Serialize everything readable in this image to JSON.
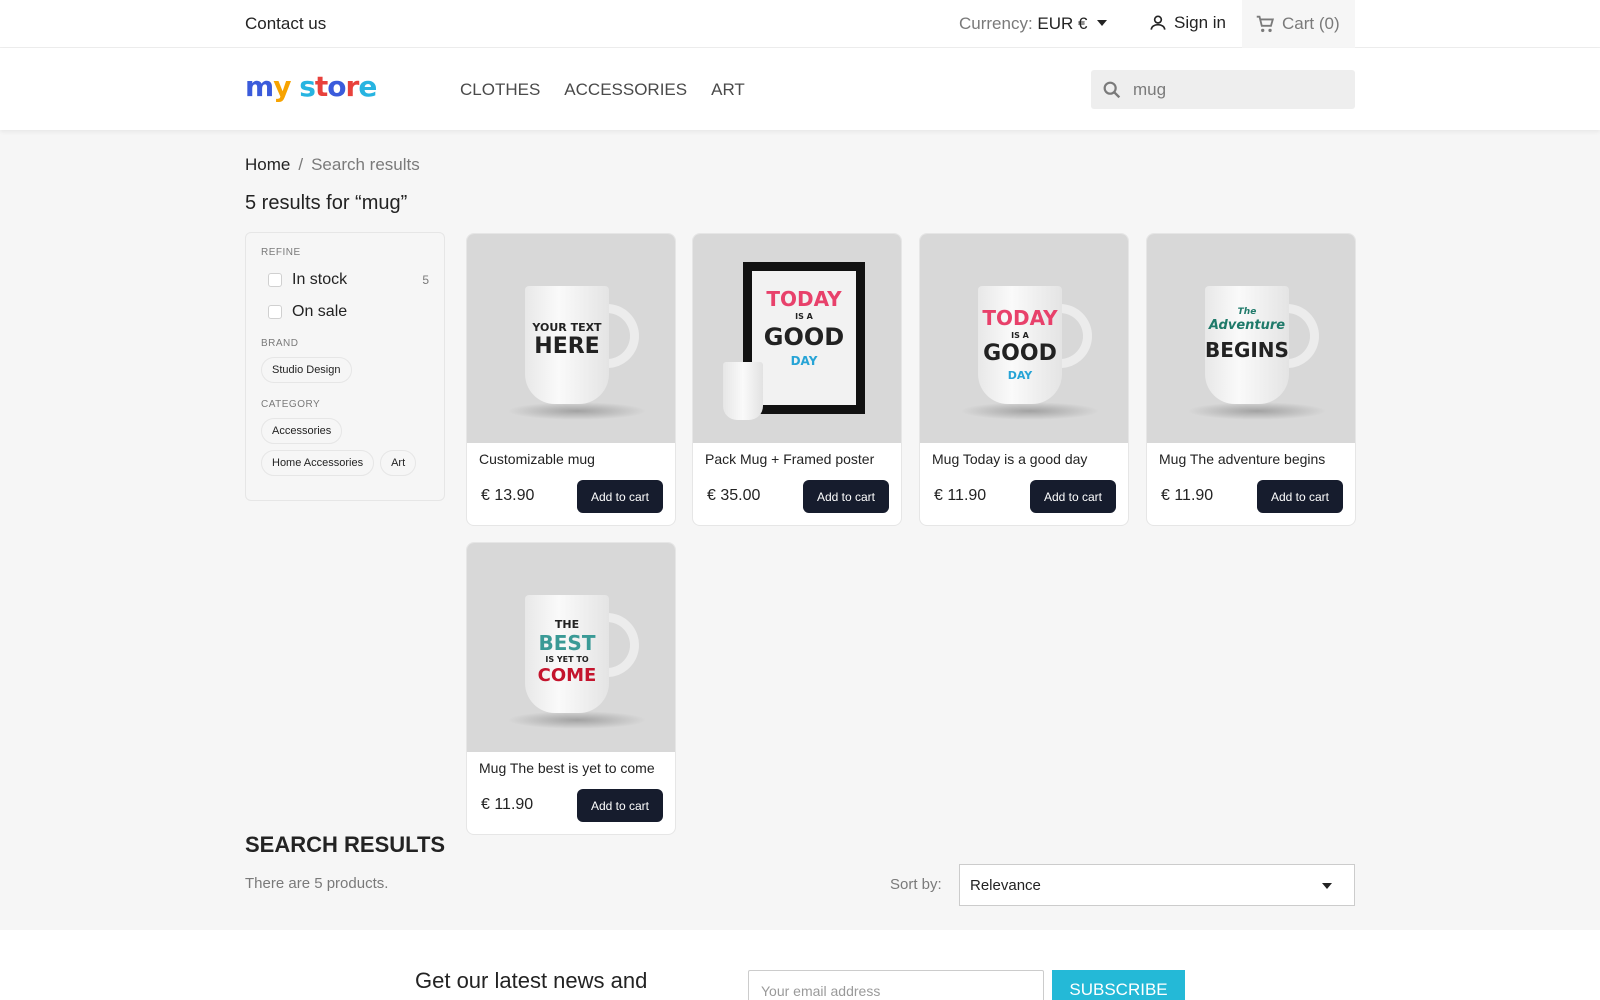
{
  "topbar": {
    "contact": "Contact us",
    "currency_label": "Currency:",
    "currency_value": "EUR €",
    "signin": "Sign in",
    "cart": "Cart (0)"
  },
  "header": {
    "logo_letters": [
      "m",
      "y",
      " ",
      "s",
      "t",
      "o",
      "r",
      "e"
    ],
    "nav": [
      "CLOTHES",
      "ACCESSORIES",
      "ART"
    ],
    "search_value": "mug"
  },
  "breadcrumb": {
    "home": "Home",
    "sep": "/",
    "current": "Search results"
  },
  "results_title": "5 results for “mug”",
  "facets": {
    "refine": "REFINE",
    "in_stock": "In stock",
    "in_stock_count": "5",
    "on_sale": "On sale",
    "brand": "BRAND",
    "brand_items": [
      "Studio Design"
    ],
    "category": "CATEGORY",
    "category_items": [
      "Accessories",
      "Home Accessories",
      "Art"
    ]
  },
  "products": [
    {
      "name": "Customizable mug",
      "price": "€ 13.90",
      "button": "Add to cart",
      "art": [
        "YOUR TEXT",
        "HERE"
      ]
    },
    {
      "name": "Pack Mug + Framed poster",
      "price": "€ 35.00",
      "button": "Add to cart",
      "art": [
        "TODAY",
        "IS A",
        "GOOD",
        "DAY"
      ]
    },
    {
      "name": "Mug Today is a good day",
      "price": "€ 11.90",
      "button": "Add to cart",
      "art": [
        "TODAY",
        "IS A",
        "GOOD",
        "DAY"
      ]
    },
    {
      "name": "Mug The adventure begins",
      "price": "€ 11.90",
      "button": "Add to cart",
      "art": [
        "The",
        "Adventure",
        "BEGINS"
      ]
    },
    {
      "name": "Mug The best is yet to come",
      "price": "€ 11.90",
      "button": "Add to cart",
      "art": [
        "THE",
        "BEST",
        "IS YET TO",
        "COME"
      ]
    }
  ],
  "search_results": {
    "title": "SEARCH RESULTS",
    "count": "There are 5 products.",
    "sort_label": "Sort by:",
    "sort_value": "Relevance"
  },
  "newsletter": {
    "heading": "Get our latest news and",
    "email_placeholder": "Your email address",
    "subscribe": "SUBSCRIBE"
  },
  "colors": {
    "logo": [
      "#3b5bdb",
      "#f7a300",
      "#ffffff",
      "#27b4e1",
      "#e8413c",
      "#3b5bdb",
      "#e8413c",
      "#27b4e1"
    ],
    "button_dark": "#161c2d",
    "accent": "#24b9d7"
  },
  "icons": [
    "person-icon",
    "cart-icon",
    "search-icon",
    "caret-down-icon"
  ]
}
